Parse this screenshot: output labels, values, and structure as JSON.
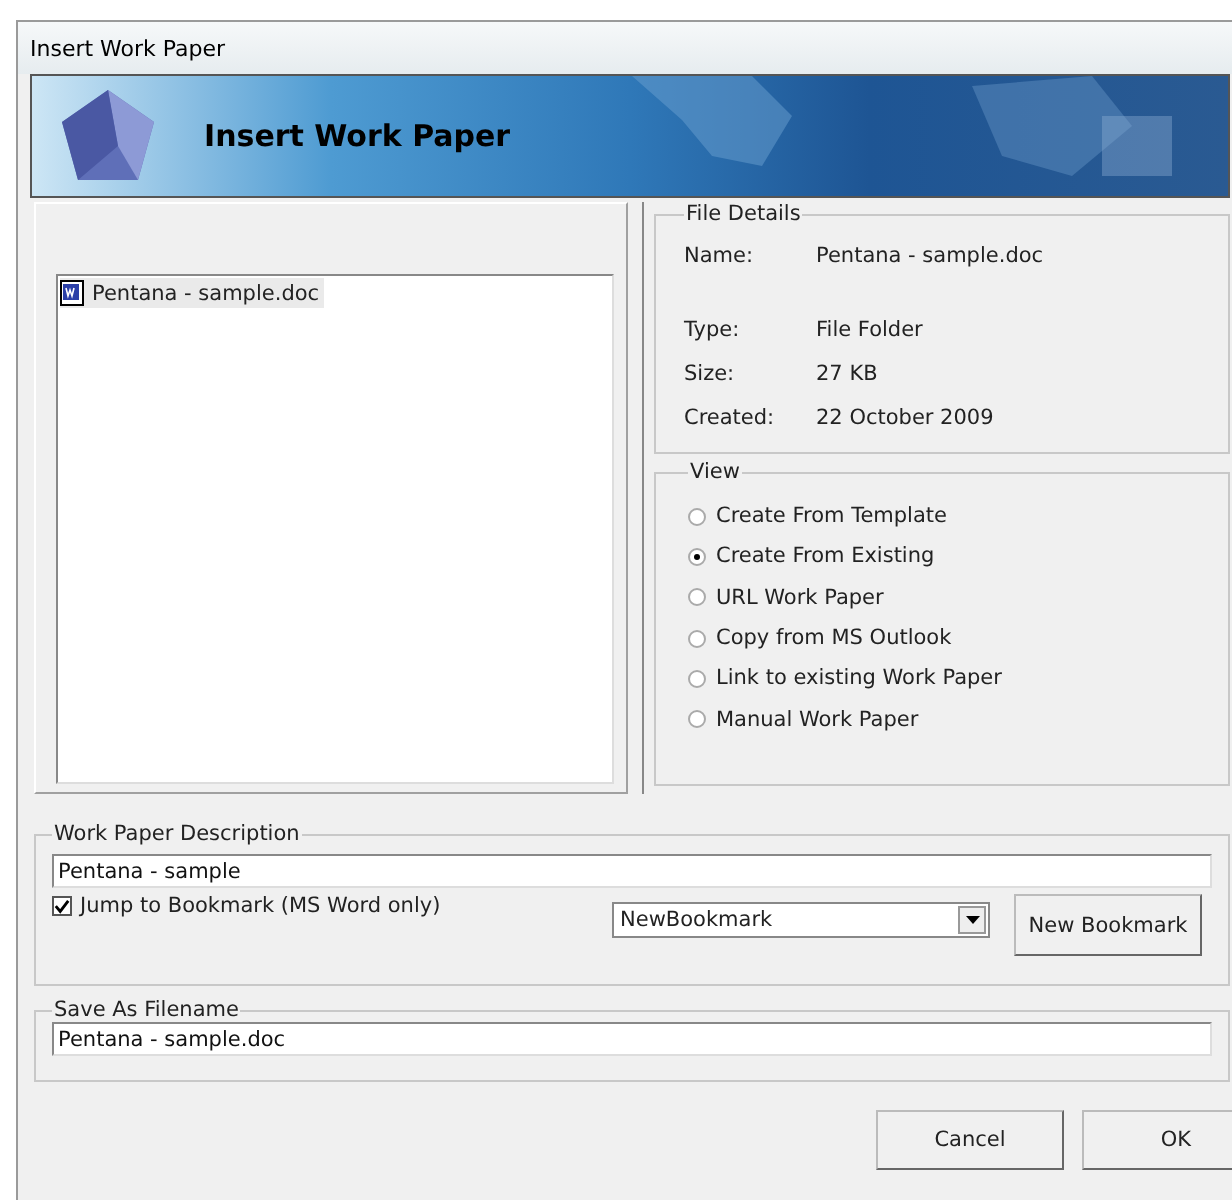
{
  "window": {
    "title": "Insert Work Paper"
  },
  "banner": {
    "title": "Insert Work Paper"
  },
  "file_list": {
    "items": [
      {
        "name": "Pentana - sample.doc",
        "selected": true
      }
    ]
  },
  "file_details": {
    "title": "File Details",
    "rows": [
      {
        "label": "Name:",
        "value": "Pentana - sample.doc"
      },
      {
        "label": "Type:",
        "value": "File Folder"
      },
      {
        "label": "Size:",
        "value": "27 KB"
      },
      {
        "label": "Created:",
        "value": "22 October 2009"
      }
    ]
  },
  "view": {
    "title": "View",
    "options": [
      {
        "label": "Create From Template",
        "selected": false
      },
      {
        "label": "Create From Existing",
        "selected": true
      },
      {
        "label": "URL Work Paper",
        "selected": false
      },
      {
        "label": "Copy from MS Outlook",
        "selected": false
      },
      {
        "label": "Link to existing Work Paper",
        "selected": false
      },
      {
        "label": "Manual Work Paper",
        "selected": false
      }
    ]
  },
  "description": {
    "title": "Work Paper Description",
    "value": "Pentana - sample",
    "jump_checkbox": {
      "label": "Jump to Bookmark (MS Word only)",
      "checked": true
    },
    "bookmark_dropdown": {
      "value": "NewBookmark"
    },
    "new_bookmark_button": "New Bookmark"
  },
  "save_as": {
    "title": "Save As Filename",
    "value": "Pentana - sample.doc"
  },
  "buttons": [
    "Cancel",
    "OK"
  ]
}
